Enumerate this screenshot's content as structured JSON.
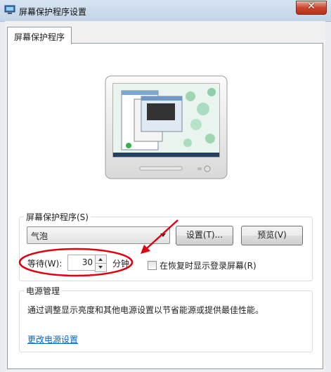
{
  "window": {
    "title": "屏幕保护程序设置",
    "close_glyph": "✕"
  },
  "tab": {
    "label": "屏幕保护程序"
  },
  "screensaver": {
    "group_label": "屏幕保护程序(S)",
    "selected": "气泡",
    "settings_button": "设置(T)...",
    "preview_button": "预览(V)",
    "wait_label": "等待(W):",
    "wait_value": "30",
    "wait_unit": "分钟",
    "resume_checkbox_label": "在恢复时显示登录屏幕(R)",
    "resume_checked": false
  },
  "power": {
    "group_label": "电源管理",
    "description": "通过调整显示亮度和其他电源设置以节省能源或提供最佳性能。",
    "link": "更改电源设置"
  },
  "colors": {
    "annotation": "#e00010",
    "link": "#0066cc",
    "close": "#c9452d"
  }
}
